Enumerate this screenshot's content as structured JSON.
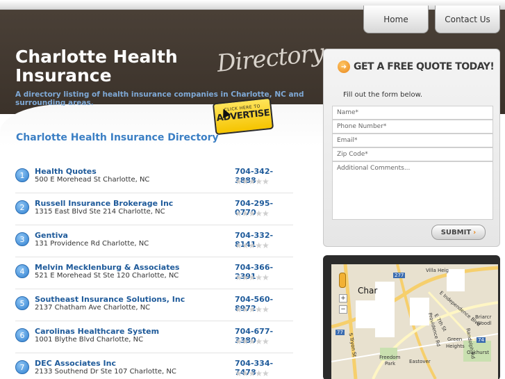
{
  "nav": {
    "home": "Home",
    "contact": "Contact Us"
  },
  "header": {
    "title": "Charlotte Health Insurance",
    "script": "Directory",
    "tagline": "A directory listing of health insurance companies in Charlotte, NC and surrounding areas."
  },
  "advertise": {
    "small": "CLICK HERE TO",
    "big": "ADVERTISE"
  },
  "main": {
    "title": "Charlotte Health Insurance Directory"
  },
  "listings": [
    {
      "num": "1",
      "name": "Health Quotes",
      "address": "500 E Morehead St Charlotte, NC",
      "phone": "704-342-3888",
      "stars": "★★★★★"
    },
    {
      "num": "2",
      "name": "Russell Insurance Brokerage Inc",
      "address": "1315 East Blvd Ste 214 Charlotte, NC",
      "phone": "704-295-0770",
      "stars": "★★★★★"
    },
    {
      "num": "3",
      "name": "Gentiva",
      "address": "131 Providence Rd Charlotte, NC",
      "phone": "704-332-8141",
      "stars": "★★★★★"
    },
    {
      "num": "4",
      "name": "Melvin Mecklenburg & Associates",
      "address": "521 E Morehead St Ste 120 Charlotte, NC",
      "phone": "704-366-2391",
      "stars": "★★★★★"
    },
    {
      "num": "5",
      "name": "Southeast Insurance Solutions, Inc",
      "address": "2137 Chatham Ave Charlotte, NC",
      "phone": "704-560-8972",
      "stars": "★★★★★"
    },
    {
      "num": "6",
      "name": "Carolinas Healthcare System",
      "address": "1001 Blythe Blvd Charlotte, NC",
      "phone": "704-677-3380",
      "stars": "★★★★★"
    },
    {
      "num": "7",
      "name": "DEC Associates Inc",
      "address": "2133 Southend Dr Ste 107 Charlotte, NC",
      "phone": "704-334-7478",
      "stars": "★★★★★"
    }
  ],
  "quote": {
    "title": "GET A FREE QUOTE TODAY!",
    "subtitle": "Fill out the form below.",
    "name_placeholder": "Name*",
    "phone_placeholder": "Phone Number*",
    "email_placeholder": "Email*",
    "zip_placeholder": "Zip Code*",
    "comments_placeholder": "Additional Comments...",
    "submit": "SUBMIT"
  },
  "map": {
    "city": "Char",
    "labels": [
      "Villa Heig",
      "Briarcr",
      "Woodl",
      "Green",
      "Heights",
      "Oakhurst",
      "Freedom",
      "Park",
      "Eastover",
      "Providence Rd",
      "E 7th St",
      "E Independence Blvd",
      "Randolph Rd",
      "S Tryon St",
      "277",
      "77",
      "74"
    ],
    "zoom_in": "+",
    "zoom_out": "−"
  },
  "colors": {
    "header_bg": "#3b322a",
    "accent_blue": "#3b7fc4",
    "link_blue": "#1e5a9a",
    "advertise_yellow": "#f5c400",
    "quote_orange": "#e8861b"
  }
}
